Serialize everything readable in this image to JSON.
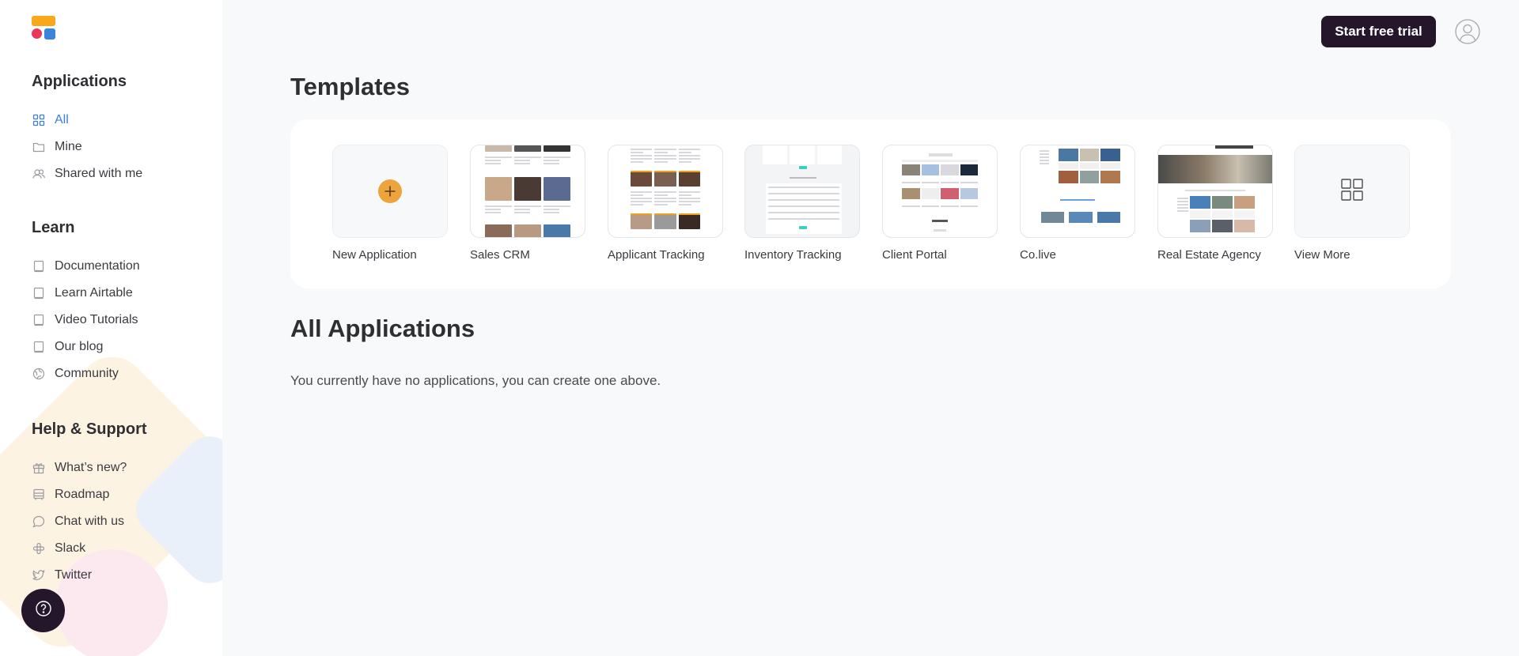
{
  "sidebar": {
    "logo_name": "app-logo",
    "sections": [
      {
        "title": "Applications",
        "items": [
          {
            "label": "All",
            "icon": "grid-icon",
            "active": true
          },
          {
            "label": "Mine",
            "icon": "folder-icon",
            "active": false
          },
          {
            "label": "Shared with me",
            "icon": "users-icon",
            "active": false
          }
        ]
      },
      {
        "title": "Learn",
        "items": [
          {
            "label": "Documentation",
            "icon": "book-icon"
          },
          {
            "label": "Learn Airtable",
            "icon": "book-icon"
          },
          {
            "label": "Video Tutorials",
            "icon": "book-icon"
          },
          {
            "label": "Our blog",
            "icon": "book-icon"
          },
          {
            "label": "Community",
            "icon": "globe-icon"
          }
        ]
      },
      {
        "title": "Help & Support",
        "items": [
          {
            "label": "What’s new?",
            "icon": "gift-icon"
          },
          {
            "label": "Roadmap",
            "icon": "bus-icon"
          },
          {
            "label": "Chat with us",
            "icon": "chat-bubble-icon"
          },
          {
            "label": "Slack",
            "icon": "slack-icon"
          },
          {
            "label": "Twitter",
            "icon": "twitter-icon"
          }
        ]
      }
    ],
    "help_button_icon": "question-mark-icon"
  },
  "header": {
    "cta_label": "Start free trial",
    "avatar_icon": "user-avatar-icon"
  },
  "main": {
    "templates_title": "Templates",
    "templates": [
      {
        "label": "New Application",
        "kind": "new"
      },
      {
        "label": "Sales CRM",
        "kind": "crm"
      },
      {
        "label": "Applicant Tracking",
        "kind": "applicant"
      },
      {
        "label": "Inventory Tracking",
        "kind": "inventory"
      },
      {
        "label": "Client Portal",
        "kind": "portal"
      },
      {
        "label": "Co.live",
        "kind": "colive"
      },
      {
        "label": "Real Estate Agency",
        "kind": "realestate"
      },
      {
        "label": "View More",
        "kind": "more"
      }
    ],
    "all_apps_title": "All Applications",
    "empty_message": "You currently have no applications, you can create one above."
  },
  "colors": {
    "accent": "#3b7fd6",
    "cta_bg": "#25172b",
    "plus_circle": "#eea43c",
    "logo_orange": "#f7a81b",
    "logo_pink": "#e8365d",
    "logo_blue": "#3b84d9"
  }
}
